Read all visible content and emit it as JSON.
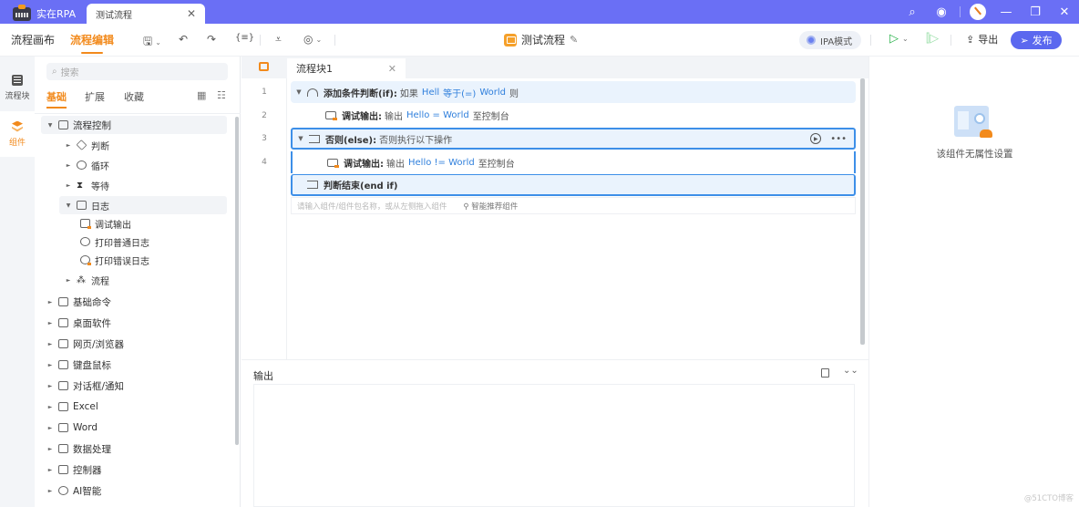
{
  "titlebar": {
    "app_name": "实在RPA",
    "doc_tab": "测试流程",
    "close_glyph": "✕",
    "icons": [
      "search-icon",
      "eye-icon",
      "avatar",
      "minimize-icon",
      "restore-icon",
      "close-icon"
    ],
    "glyphs": {
      "search": "⌕",
      "eye": "◉",
      "minimize": "—",
      "restore": "❐",
      "close": "✕"
    }
  },
  "toolbar": {
    "mode_tabs": [
      {
        "label": "流程画布",
        "active": false
      },
      {
        "label": "流程编辑",
        "active": true
      }
    ],
    "tools": [
      {
        "name": "save",
        "glyph": "🖫",
        "dropdown": true
      },
      {
        "name": "undo",
        "glyph": "↶",
        "dropdown": false
      },
      {
        "name": "redo",
        "glyph": "↷",
        "dropdown": false
      },
      {
        "name": "variables",
        "glyph": "{≡}",
        "dropdown": false
      },
      {
        "name": "record",
        "glyph": "⩡",
        "dropdown": false
      },
      {
        "name": "ai",
        "glyph": "◎",
        "dropdown": true
      }
    ],
    "caret": "⌄",
    "flow_title": "测试流程",
    "edit_glyph": "✎",
    "ipa_mode": "IPA模式",
    "run_glyph": "▷",
    "step_glyph": "⫿▷",
    "export_glyph": "⇪",
    "export_label": "导出",
    "publish_glyph": "➢",
    "publish_label": "发布",
    "accent": "#f28a1c",
    "publish_color": "#5b68ef"
  },
  "rail": {
    "items": [
      {
        "label": "流程块",
        "active": false
      },
      {
        "label": "组件",
        "active": true
      }
    ]
  },
  "panel": {
    "search_glyph": "⌕",
    "search_placeholder": "搜索",
    "tabs": [
      {
        "label": "基础",
        "active": true
      },
      {
        "label": "扩展",
        "active": false
      },
      {
        "label": "收藏",
        "active": false
      }
    ],
    "view_icons": {
      "grid": "▦",
      "list": "☷"
    },
    "tree": [
      {
        "label": "流程控制",
        "level": 0,
        "expanded": true,
        "highlight": true
      },
      {
        "label": "判断",
        "level": 1,
        "expanded": false
      },
      {
        "label": "循环",
        "level": 1,
        "expanded": false
      },
      {
        "label": "等待",
        "level": 1,
        "expanded": false
      },
      {
        "label": "日志",
        "level": 1,
        "expanded": true,
        "highlight": true
      },
      {
        "label": "调试输出",
        "level": 2
      },
      {
        "label": "打印普通日志",
        "level": 2
      },
      {
        "label": "打印错误日志",
        "level": 2
      },
      {
        "label": "流程",
        "level": 1,
        "expanded": false
      },
      {
        "label": "基础命令",
        "level": 0,
        "expanded": false
      },
      {
        "label": "桌面软件",
        "level": 0,
        "expanded": false
      },
      {
        "label": "网页/浏览器",
        "level": 0,
        "expanded": false
      },
      {
        "label": "键盘鼠标",
        "level": 0,
        "expanded": false
      },
      {
        "label": "对话框/通知",
        "level": 0,
        "expanded": false
      },
      {
        "label": "Excel",
        "level": 0,
        "expanded": false
      },
      {
        "label": "Word",
        "level": 0,
        "expanded": false
      },
      {
        "label": "数据处理",
        "level": 0,
        "expanded": false
      },
      {
        "label": "控制器",
        "level": 0,
        "expanded": false
      },
      {
        "label": "AI智能",
        "level": 0,
        "expanded": false
      }
    ],
    "arrow_expanded": "▼",
    "arrow_collapsed": "►"
  },
  "editor": {
    "tab_label": "流程块1",
    "tab_close": "✕",
    "line_numbers": [
      "1",
      "2",
      "3",
      "4"
    ],
    "rows": [
      {
        "key": "添加条件判断(if):",
        "parts": [
          [
            "txt",
            "如果"
          ],
          [
            "blue",
            "Hell"
          ],
          [
            "blue",
            "等于(=)"
          ],
          [
            "blue",
            "World"
          ],
          [
            "txt",
            "则"
          ]
        ]
      },
      {
        "key": "调试输出:",
        "parts": [
          [
            "txt",
            "输出"
          ],
          [
            "blue",
            "Hello = World"
          ],
          [
            "txt",
            "至控制台"
          ]
        ]
      },
      {
        "key": "否则(else):",
        "parts": [
          [
            "txt",
            "否则执行以下操作"
          ]
        ]
      },
      {
        "key": "调试输出:",
        "parts": [
          [
            "txt",
            "输出"
          ],
          [
            "blue",
            "Hello != World"
          ],
          [
            "txt",
            "至控制台"
          ]
        ]
      },
      {
        "key": "判断结束(end if)",
        "parts": []
      }
    ],
    "row_arrow": "▼",
    "row_run_glyph": "▶",
    "row_more_glyph": "•••",
    "add_placeholder": "请输入组件/组件包名称，或从左侧拖入组件",
    "smart_recommend": "⚲ 智能推荐组件"
  },
  "output": {
    "title": "输出",
    "collapse_glyph": "⌄⌄"
  },
  "properties": {
    "empty_text": "该组件无属性设置"
  },
  "watermark": "@51CTO博客"
}
